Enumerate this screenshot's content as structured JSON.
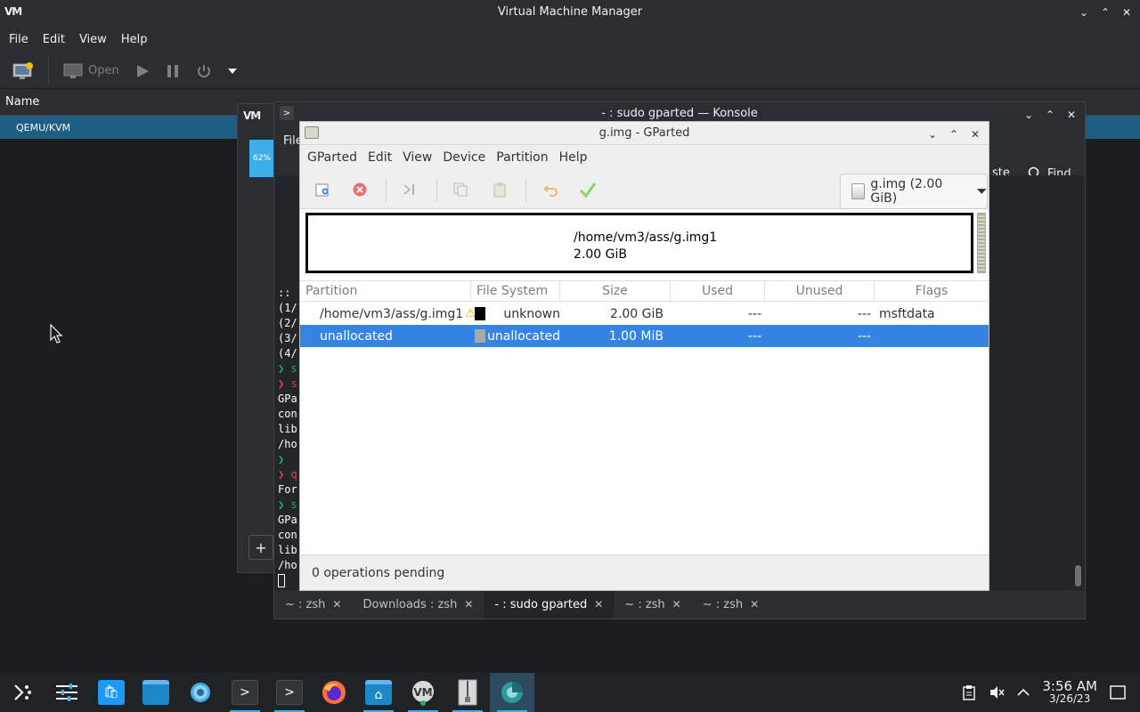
{
  "vmm": {
    "title": "Virtual Machine Manager",
    "logo": "VM",
    "menu": [
      "File",
      "Edit",
      "View",
      "Help"
    ],
    "toolbar": {
      "open_label": "Open"
    },
    "column_name": "Name",
    "connection": "QEMU/KVM"
  },
  "bg_dialog": {
    "logo": "VM",
    "progress": "62%",
    "add": "+"
  },
  "konsole": {
    "title": "- : sudo gparted — Konsole",
    "file_label": "File",
    "paste_label": "ste",
    "find_label": "Find",
    "lines": [
      "::",
      "(1/",
      "(2/",
      "(3/",
      "(4/",
      "❯ s",
      "❯ s",
      "GPa",
      "con",
      "lib",
      "/ho",
      "❯",
      "❯ q",
      "For",
      "❯ s",
      "GPa",
      "con",
      "lib",
      "/ho"
    ],
    "tabs": [
      {
        "label": "~ : zsh",
        "close": "✕"
      },
      {
        "label": "Downloads : zsh",
        "close": "✕"
      },
      {
        "label": "- : sudo gparted",
        "close": "✕"
      },
      {
        "label": "~ : zsh",
        "close": "✕"
      },
      {
        "label": "~ : zsh",
        "close": "✕"
      }
    ]
  },
  "gparted": {
    "title": "g.img - GParted",
    "menu": [
      "GParted",
      "Edit",
      "View",
      "Device",
      "Partition",
      "Help"
    ],
    "device": "g.img (2.00 GiB)",
    "diskmap": {
      "path": "/home/vm3/ass/g.img1",
      "size": "2.00 GiB"
    },
    "columns": [
      "Partition",
      "File System",
      "Size",
      "Used",
      "Unused",
      "Flags"
    ],
    "rows": [
      {
        "partition": "/home/vm3/ass/g.img1",
        "fs": "unknown",
        "fs_color": "#000000",
        "size": "2.00 GiB",
        "used": "---",
        "unused": "---",
        "flags": "msftdata",
        "warning": "⚠"
      },
      {
        "partition": "unallocated",
        "fs": "unallocated",
        "fs_color": "#a9a9a9",
        "size": "1.00 MiB",
        "used": "---",
        "unused": "---",
        "flags": ""
      }
    ],
    "status": "0 operations pending"
  },
  "tray": {
    "time": "3:56 AM",
    "date": "3/26/23"
  },
  "colors": {
    "accent": "#3daee9",
    "selection": "#3584e4",
    "vmm_selection": "#1d5e82"
  }
}
